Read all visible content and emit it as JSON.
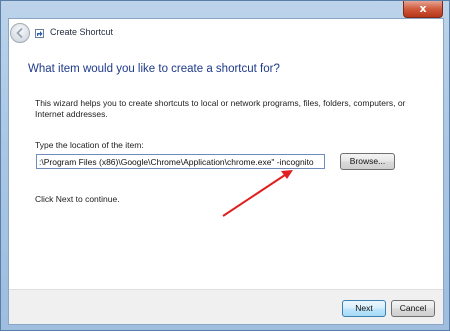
{
  "window": {
    "title": "Create Shortcut",
    "close_glyph": "x"
  },
  "main": {
    "heading": "What item would you like to create a shortcut for?",
    "description": "This wizard helps you to create shortcuts to local or network programs, files, folders, computers, or Internet addresses.",
    "location_label": "Type the location of the item:",
    "location_value": ":\\Program Files (x86)\\Google\\Chrome\\Application\\chrome.exe\" -incognito",
    "browse_label": "Browse...",
    "next_instruction": "Click Next to continue."
  },
  "footer": {
    "next_label": "Next",
    "cancel_label": "Cancel"
  },
  "annotation": {
    "arrow_color": "#e02020"
  },
  "icons": [
    "back-arrow-icon",
    "shortcut-wizard-icon",
    "close-icon"
  ]
}
